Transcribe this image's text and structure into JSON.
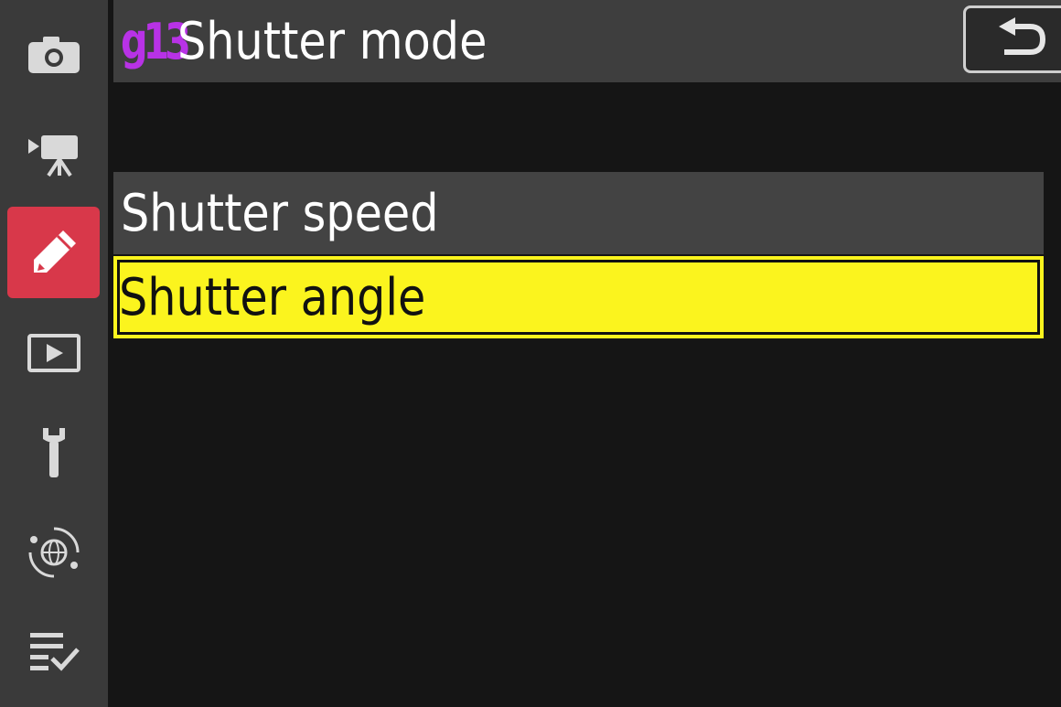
{
  "sidebar": {
    "tabs": [
      {
        "icon": "camera-icon",
        "active": false
      },
      {
        "icon": "movie-camera-icon",
        "active": false
      },
      {
        "icon": "pencil-icon",
        "active": true
      },
      {
        "icon": "playback-icon",
        "active": false
      },
      {
        "icon": "wrench-icon",
        "active": false
      },
      {
        "icon": "network-icon",
        "active": false
      },
      {
        "icon": "my-menu-icon",
        "active": false
      }
    ]
  },
  "header": {
    "code": "g13",
    "code_color": "#b832e6",
    "title": "Shutter mode",
    "back_icon": "back-arrow-icon"
  },
  "menu": {
    "items": [
      {
        "label": "Shutter speed",
        "selected": false
      },
      {
        "label": "Shutter angle",
        "selected": true
      }
    ]
  },
  "colors": {
    "background": "#151515",
    "sidebar": "#3a3a3a",
    "active_tab": "#d8384a",
    "selected_item": "#fbf41e",
    "unselected_item": "#434343"
  }
}
